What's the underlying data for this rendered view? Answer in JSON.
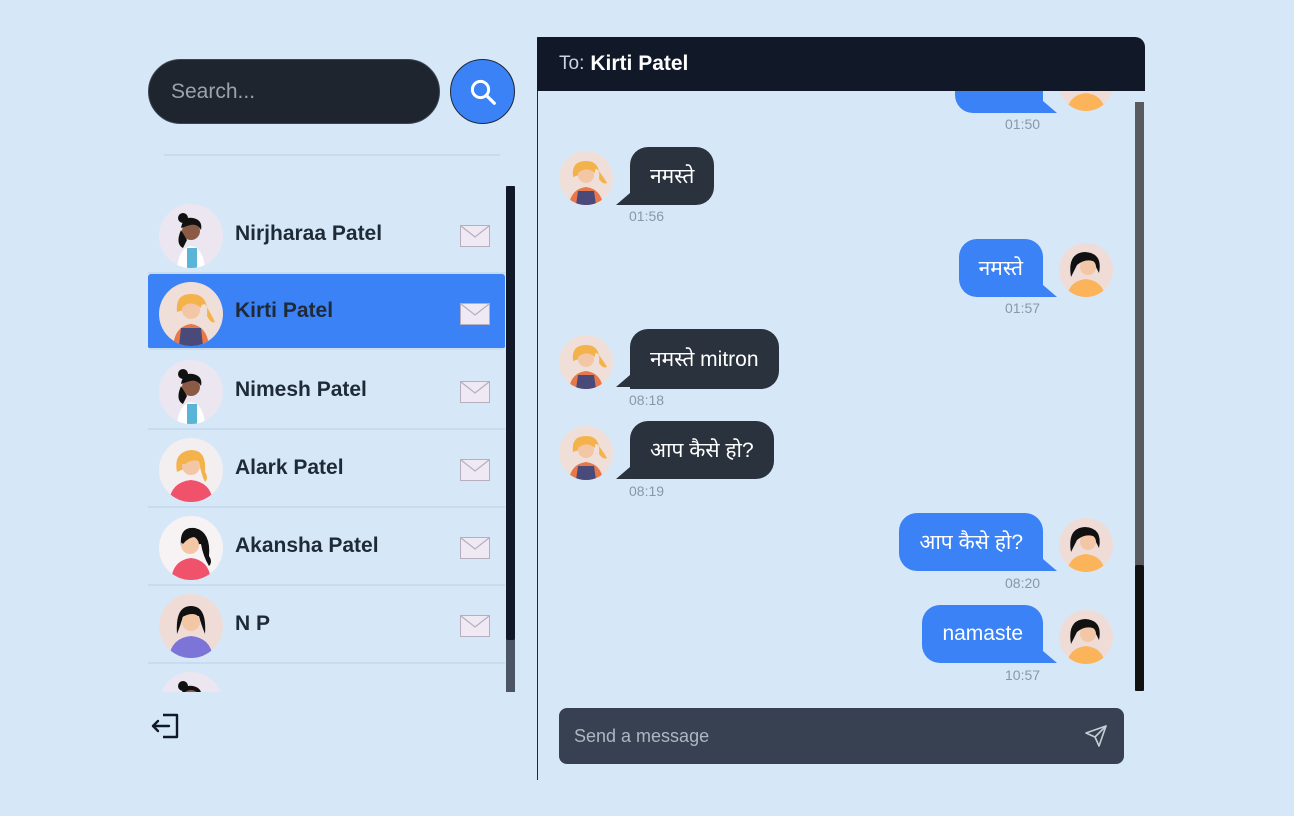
{
  "search": {
    "placeholder": "Search..."
  },
  "sidebar": {
    "contacts": [
      {
        "name": "Nirjharaa Patel",
        "avatar": "avatar-woman-curly-white-shirt",
        "active": false
      },
      {
        "name": "Kirti Patel",
        "avatar": "avatar-woman-blonde-apron",
        "active": true
      },
      {
        "name": "Nimesh Patel",
        "avatar": "avatar-woman-curly-white-shirt",
        "active": false
      },
      {
        "name": "Alark Patel",
        "avatar": "avatar-woman-blonde-pink",
        "active": false
      },
      {
        "name": "Akansha Patel",
        "avatar": "avatar-woman-dark-hair-pink",
        "active": false
      },
      {
        "name": "N P",
        "avatar": "avatar-woman-dark-hair-purple",
        "active": false
      }
    ]
  },
  "chat": {
    "to_label": "To:",
    "recipient": "Kirti Patel",
    "messages": [
      {
        "direction": "out",
        "text": "",
        "time": "01:50"
      },
      {
        "direction": "in",
        "text": "नमस्ते",
        "time": "01:56"
      },
      {
        "direction": "out",
        "text": "नमस्ते",
        "time": "01:57"
      },
      {
        "direction": "in",
        "text": "नमस्ते mitron",
        "time": "08:18"
      },
      {
        "direction": "in",
        "text": "आप कैसे हो?",
        "time": "08:19"
      },
      {
        "direction": "out",
        "text": "आप कैसे हो?",
        "time": "08:20"
      },
      {
        "direction": "out",
        "text": "namaste",
        "time": "10:57"
      }
    ],
    "composer_placeholder": "Send a message"
  },
  "colors": {
    "background": "#d6e8f8",
    "accent": "#3b82f6",
    "header": "#111827",
    "incoming_bubble": "#2a323d"
  },
  "icons": {
    "search": "search-icon",
    "mail": "mail-icon",
    "logout": "logout-icon",
    "send": "send-icon"
  }
}
